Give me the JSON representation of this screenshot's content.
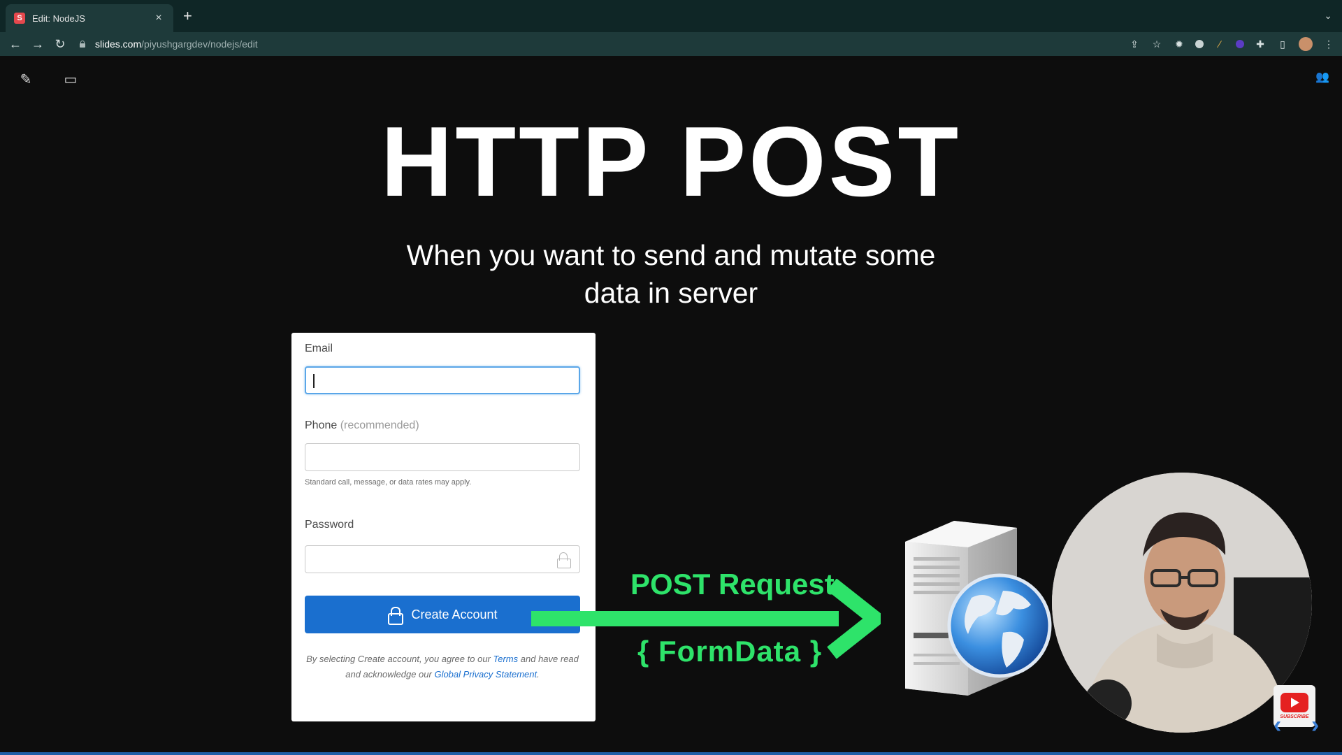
{
  "browser": {
    "tab_title": "Edit: NodeJS",
    "tab_favicon_letter": "S",
    "url_host": "slides.com",
    "url_path": "/piyushgargdev/nodejs/edit"
  },
  "slide": {
    "title": "HTTP POST",
    "subtitle": "When you want to send and mutate some data in server"
  },
  "form": {
    "email_label": "Email",
    "phone_label": "Phone",
    "phone_hint": "(recommended)",
    "phone_note": "Standard call, message, or data rates may apply.",
    "password_label": "Password",
    "create_button": "Create Account",
    "terms_pre": "By selecting Create account, you agree to our",
    "terms_link": "Terms",
    "terms_mid": "and have read and acknowledge our",
    "privacy_link": "Global Privacy Statement",
    "terms_end": "."
  },
  "diagram": {
    "request_label": "POST Request",
    "payload_label": "{ FormData }",
    "accent_color": "#2ee36a"
  },
  "badge": {
    "subscribe_text": "SUBSCRIBE"
  }
}
